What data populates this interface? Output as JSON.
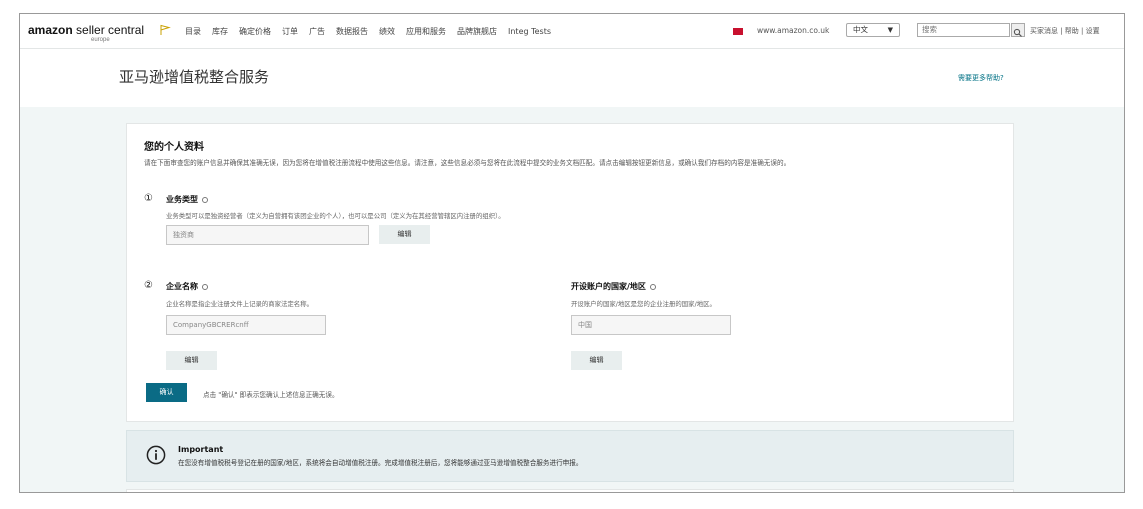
{
  "nav": {
    "logo_main": "amazon",
    "logo_rest": " seller central",
    "logo_sub": "europe",
    "menu": [
      "目录",
      "库存",
      "确定价格",
      "订单",
      "广告",
      "数据报告",
      "绩效",
      "应用和服务",
      "品牌旗舰店",
      "Integ Tests"
    ],
    "marketplace": "www.amazon.co.uk",
    "language": "中文",
    "search_placeholder": "搜索",
    "top_links": "买家消息 | 帮助 | 设置"
  },
  "header": {
    "title": "亚马逊增值税整合服务",
    "help_link": "需要更多帮助?"
  },
  "profile": {
    "title": "您的个人资料",
    "description": "请在下面审查您的账户信息并确保其准确无误，因为您将在增值税注册流程中使用这些信息。请注意，这些信息必须与您将在此流程中提交的业务文档匹配。请点击编辑按钮更新信息，或确认我们存档的内容是准确无误的。",
    "business_type": {
      "number": "①",
      "title": "业务类型",
      "description": "业务类型可以是独资经营者（定义为自营拥有该团企业的个人），也可以是公司（定义为在其经营管辖区内注册的组织）。",
      "value": "独资商",
      "edit_label": "编辑"
    },
    "company_name": {
      "number": "②",
      "title": "企业名称",
      "description": "企业名称是指企业注册文件上记录的商家法定名称。",
      "value": "CompanyGBCRERcnff",
      "edit_label": "编辑"
    },
    "country": {
      "title": "开设账户的国家/地区",
      "description": "开设账户的国家/地区是您的企业注册的国家/地区。",
      "value": "中国",
      "edit_label": "编辑"
    },
    "confirm_label": "确认",
    "confirm_note": "点击 \"确认\" 即表示您确认上述信息正确无误。"
  },
  "important": {
    "title": "Important",
    "text": "在您没有增值税税号登记在册的国家/地区，系统将会自动增值税注册。完成增值税注册后，您将能够通过亚马逊增值税整合服务进行申报。"
  },
  "colors": {
    "accent": "#0a6b85",
    "page_bg": "#f1f6f6",
    "important_bg": "#e6eef0",
    "link": "#007185"
  }
}
